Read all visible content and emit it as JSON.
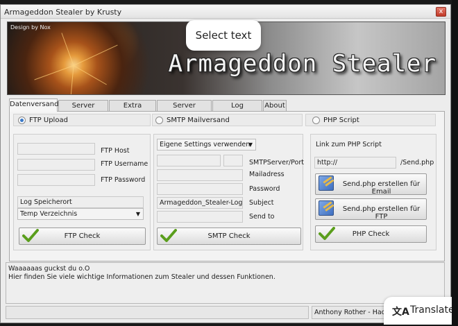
{
  "window": {
    "title": "Armageddon Stealer by Krusty",
    "close_label": "x"
  },
  "banner": {
    "credit": "Design by Nox",
    "logo_text": "Armageddon Stealer"
  },
  "overlays": {
    "select_text": "Select text",
    "translate_label": "Translate",
    "translate_icon": "translate-icon"
  },
  "tabs": [
    {
      "label": "Datenversand",
      "active": true
    },
    {
      "label": "Server Settings"
    },
    {
      "label": "Extra Settings"
    },
    {
      "label": "Server erstellen"
    },
    {
      "label": "Log decrypting"
    },
    {
      "label": "About"
    }
  ],
  "methods": {
    "ftp": {
      "label": "FTP Upload",
      "selected": true
    },
    "smtp": {
      "label": "SMTP Mailversand",
      "selected": false
    },
    "php": {
      "label": "PHP Script",
      "selected": false
    }
  },
  "ftp": {
    "host_label": "FTP Host",
    "host_value": "",
    "username_label": "FTP Username",
    "username_value": "",
    "password_label": "FTP Password",
    "password_value": "",
    "log_location_value": "Log Speicherort",
    "dir_select_value": "Temp Verzeichnis",
    "check_button": "FTP Check"
  },
  "smtp": {
    "settings_select_value": "Eigene Settings verwenden",
    "server_port_label": "SMTPServer/Port",
    "mailaddress_label": "Mailadress",
    "password_label": "Password",
    "subject_label": "Subject",
    "subject_value": "Armageddon_Stealer-Logs",
    "sendto_label": "Send to",
    "check_button": "SMTP Check"
  },
  "php": {
    "link_label": "Link zum PHP Script",
    "url_value": "http://",
    "url_suffix": "/Send.php",
    "email_button": "Send.php erstellen für Email",
    "ftp_button": "Send.php erstellen für FTP",
    "check_button": "PHP Check"
  },
  "log": {
    "line1": "Waaaaaas guckst du o.O",
    "line2": "Hier finden Sie viele wichtige Informationen zum Stealer und dessen Funktionen."
  },
  "status": {
    "author": "Anthony Rother - Hacke"
  }
}
